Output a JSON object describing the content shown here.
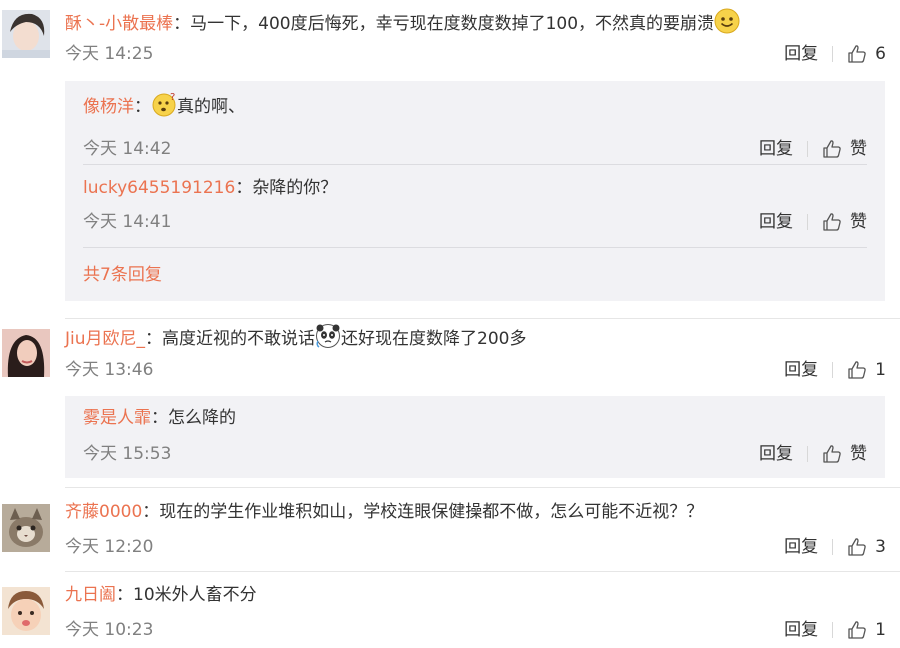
{
  "comments": [
    {
      "username": "酥丶-小散最棒",
      "text": "马一下，400度后悔死，幸亏现在度数度数掉了100，不然真的要崩溃",
      "time": "今天 14:25",
      "reply_label": "回复",
      "likes": "6",
      "replies": [
        {
          "username": "像杨洋",
          "text": "真的啊、",
          "time": "今天 14:42",
          "reply_label": "回复",
          "like_label": "赞"
        },
        {
          "username": "lucky6455191216",
          "text": "杂降的你？",
          "time": "今天 14:41",
          "reply_label": "回复",
          "like_label": "赞"
        }
      ],
      "more_replies": "共7条回复"
    },
    {
      "username": "Jiu月欧尼_",
      "text_before_emoji": "高度近视的不敢说话",
      "text_after_emoji": "还好现在度数降了200多",
      "time": "今天 13:46",
      "reply_label": "回复",
      "likes": "1",
      "replies": [
        {
          "username": "雾是人霏",
          "text": "怎么降的",
          "time": "今天 15:53",
          "reply_label": "回复",
          "like_label": "赞"
        }
      ]
    },
    {
      "username": "齐藤0000",
      "text": "现在的学生作业堆积如山，学校连眼保健操都不做，怎么可能不近视？？",
      "time": "今天 12:20",
      "reply_label": "回复",
      "likes": "3"
    },
    {
      "username": "九日阖",
      "text": "10米外人畜不分",
      "time": "今天 10:23",
      "reply_label": "回复",
      "likes": "1"
    }
  ],
  "colon": "：",
  "colors": {
    "username": "#eb7350",
    "reply_bg": "#f2f2f5",
    "time": "#808080"
  },
  "icons": {
    "like": "thumbs-up-icon",
    "smile": "smile-emoji",
    "confused": "confused-emoji",
    "panda": "panda-emoji"
  }
}
